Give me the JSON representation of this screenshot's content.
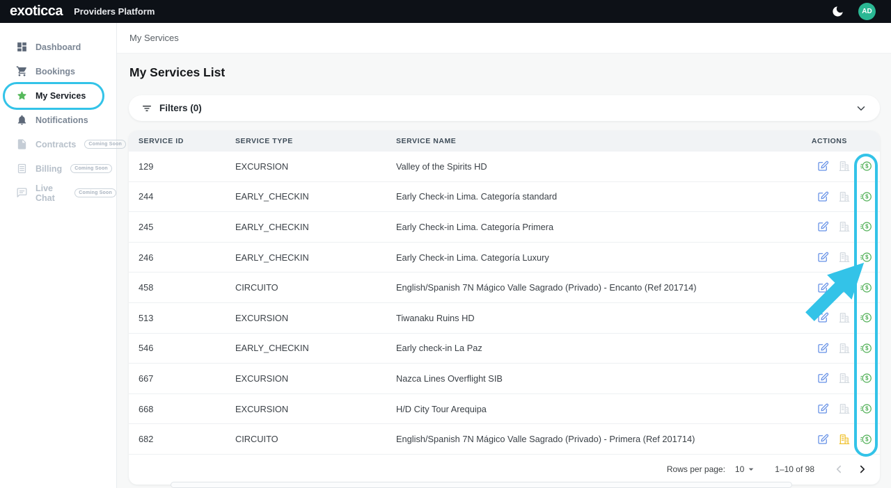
{
  "header": {
    "logo": "exoticca",
    "app_title": "Providers Platform",
    "avatar_initials": "AD"
  },
  "sidebar": {
    "items": [
      {
        "label": "Dashboard",
        "icon": "dashboard-icon",
        "active": false,
        "disabled": false
      },
      {
        "label": "Bookings",
        "icon": "cart-icon",
        "active": false,
        "disabled": false
      },
      {
        "label": "My Services",
        "icon": "star-icon",
        "active": true,
        "disabled": false
      },
      {
        "label": "Notifications",
        "icon": "bell-icon",
        "active": false,
        "disabled": false
      },
      {
        "label": "Contracts",
        "icon": "document-icon",
        "badge": "Coming Soon",
        "disabled": true
      },
      {
        "label": "Billing",
        "icon": "receipt-icon",
        "badge": "Coming Soon",
        "disabled": true
      },
      {
        "label": "Live Chat",
        "icon": "chat-icon",
        "badge": "Coming Soon",
        "disabled": true
      }
    ]
  },
  "breadcrumb": "My Services",
  "page": {
    "title": "My Services List"
  },
  "filters": {
    "label": "Filters (0)",
    "filter_icon": "filter-lines-icon",
    "expand_icon": "chevron-down-icon"
  },
  "table": {
    "columns": [
      "SERVICE ID",
      "SERVICE TYPE",
      "SERVICE NAME",
      "ACTIONS"
    ],
    "row_action_icons": [
      "edit-icon",
      "hotel-building-icon",
      "prices-dollar-icon"
    ],
    "rows": [
      {
        "id": "129",
        "type": "EXCURSION",
        "name": "Valley of the Spirits HD"
      },
      {
        "id": "244",
        "type": "EARLY_CHECKIN",
        "name": "Early Check-in Lima. Categoría standard"
      },
      {
        "id": "245",
        "type": "EARLY_CHECKIN",
        "name": "Early Check-in Lima. Categoría Primera"
      },
      {
        "id": "246",
        "type": "EARLY_CHECKIN",
        "name": "Early Check-in Lima. Categoría Luxury"
      },
      {
        "id": "458",
        "type": "CIRCUITO",
        "name": "English/Spanish 7N Mágico Valle Sagrado (Privado) - Encanto (Ref 201714)"
      },
      {
        "id": "513",
        "type": "EXCURSION",
        "name": "Tiwanaku Ruins HD"
      },
      {
        "id": "546",
        "type": "EARLY_CHECKIN",
        "name": "Early check-in La Paz"
      },
      {
        "id": "667",
        "type": "EXCURSION",
        "name": "Nazca Lines Overflight SIB"
      },
      {
        "id": "668",
        "type": "EXCURSION",
        "name": "H/D City Tour Arequipa"
      },
      {
        "id": "682",
        "type": "CIRCUITO",
        "name": "English/Spanish 7N Mágico Valle Sagrado (Privado) - Primera (Ref 201714)"
      }
    ]
  },
  "pagination": {
    "rows_per_page_label": "Rows per page:",
    "rows_per_page_value": "10",
    "range_label": "1–10 of 98",
    "prev_icon": "chevron-left-icon",
    "next_icon": "chevron-right-icon"
  },
  "annotations": {
    "highlight_color": "#33C3E8",
    "highlighted_target": "prices-column and My Services nav item",
    "cursor": "arrow-pointer"
  },
  "colors": {
    "header_bg": "#0D1117",
    "accent_cyan": "#33C3E8",
    "star_green": "#56B95C",
    "edit_blue": "#6590E6",
    "dollar_green": "#4CAE52",
    "warning_yellow": "#F0C231",
    "avatar_teal": "#2AB793"
  }
}
